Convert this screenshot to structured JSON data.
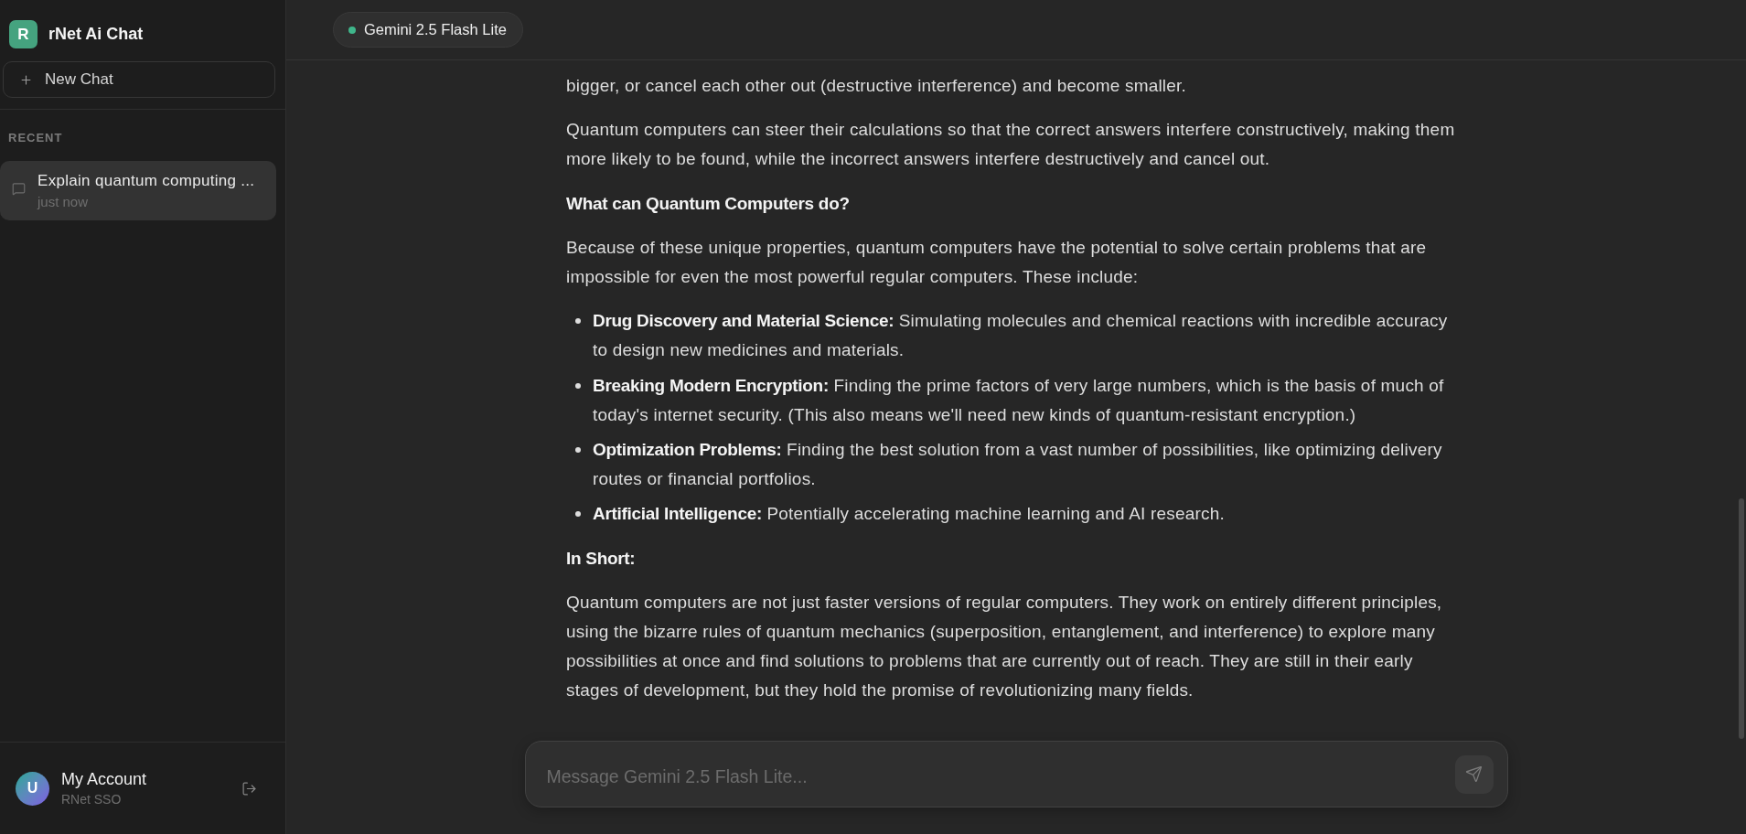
{
  "sidebar": {
    "logo": "R",
    "title": "rNet Ai Chat",
    "new_chat": "New Chat",
    "section": "RECENT",
    "chats": [
      {
        "title": "Explain quantum computing ...",
        "time": "just now",
        "selected": true
      }
    ],
    "account": {
      "avatar": "U",
      "name": "My Account",
      "provider": "RNet SSO"
    }
  },
  "header": {
    "model": {
      "name": "Gemini 2.5 Flash Lite",
      "active": true
    }
  },
  "response": {
    "blocks": [
      {
        "kind": "paragraph",
        "text": "bigger, or cancel each other out (destructive interference) and become smaller."
      },
      {
        "kind": "paragraph",
        "text": "Quantum computers can steer their calculations so that the correct answers interfere constructively, making them more likely to be found, while the incorrect answers interfere destructively and cancel out."
      },
      {
        "kind": "heading",
        "text": "What can Quantum Computers do?"
      },
      {
        "kind": "paragraph",
        "text": "Because of these unique properties, quantum computers have the potential to solve certain problems that are impossible for even the most powerful regular computers. These include:"
      },
      {
        "kind": "list",
        "items": [
          "**Drug Discovery and Material Science:** Simulating molecules and chemical reactions with incredible accuracy to design new medicines and materials.",
          "**Breaking Modern Encryption:** Finding the prime factors of very large numbers, which is the basis of much of today's internet security. (This also means we'll need new kinds of quantum-resistant encryption.)",
          "**Optimization Problems:** Finding the best solution from a vast number of possibilities, like optimizing delivery routes or financial portfolios.",
          "**Artificial Intelligence:** Potentially accelerating machine learning and AI research."
        ]
      },
      {
        "kind": "heading",
        "text": "In Short:"
      },
      {
        "kind": "paragraph",
        "text": "Quantum computers are not just faster versions of regular computers. They work on entirely different principles, using the bizarre rules of quantum mechanics (superposition, entanglement, and interference) to explore many possibilities at once and find solutions to problems that are currently out of reach. They are still in their early stages of development, but they hold the promise of revolutionizing many fields."
      }
    ]
  },
  "composer": {
    "placeholder": "Message Gemini 2.5 Flash Lite...",
    "send_disabled": true
  }
}
